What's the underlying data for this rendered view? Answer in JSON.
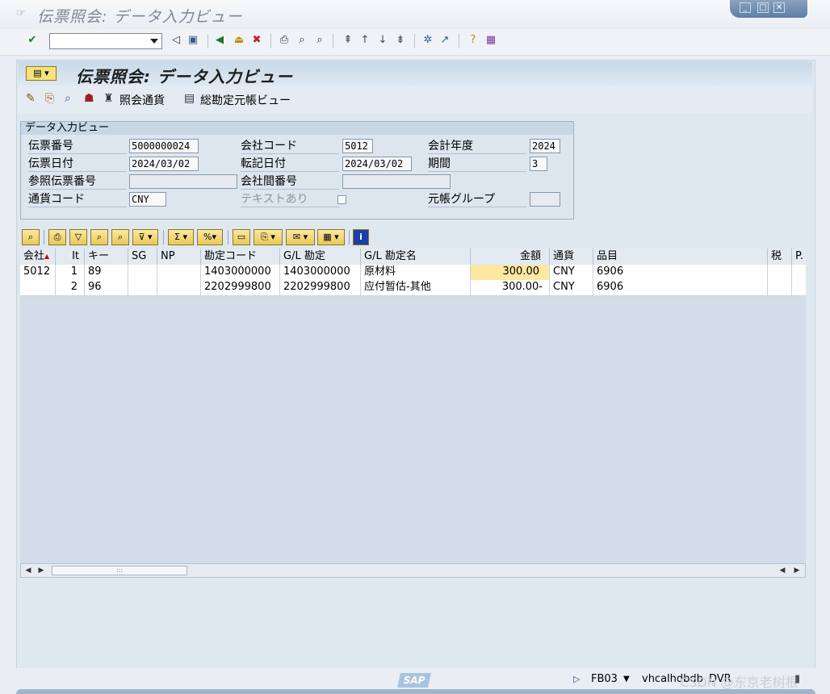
{
  "window": {
    "title": "伝票照会: データ入力ビュー",
    "buttons": [
      "minimize-icon",
      "maximize-icon",
      "close-icon"
    ]
  },
  "system_toolbar": {
    "command_field_value": "",
    "icons": [
      "enter-icon",
      "back-icon",
      "exit-icon",
      "cancel-icon",
      "print-icon",
      "find-icon",
      "find-next-icon",
      "first-page-icon",
      "prev-page-icon",
      "next-page-icon",
      "last-page-icon",
      "create-session-icon",
      "shortcut-icon",
      "help-icon",
      "customize-layout-icon"
    ]
  },
  "screen": {
    "title": "伝票照会: データ入力ビュー"
  },
  "app_toolbar": {
    "icons": [
      "display-change-icon",
      "other-document-icon",
      "overview-icon",
      "taxes-icon"
    ],
    "display_currency_label": "照会通貨",
    "general_ledger_view_label": "総勘定元帳ビュー"
  },
  "header_group": {
    "title": "データ入力ビュー",
    "fields": {
      "document_number": {
        "label": "伝票番号",
        "value": "5000000024"
      },
      "company_code": {
        "label": "会社コード",
        "value": "5012"
      },
      "fiscal_year": {
        "label": "会計年度",
        "value": "2024"
      },
      "document_date": {
        "label": "伝票日付",
        "value": "2024/03/02"
      },
      "posting_date": {
        "label": "転記日付",
        "value": "2024/03/02"
      },
      "period": {
        "label": "期間",
        "value": "3"
      },
      "reference": {
        "label": "参照伝票番号",
        "value": ""
      },
      "cross_company": {
        "label": "会社間番号",
        "value": ""
      },
      "currency": {
        "label": "通貨コード",
        "value": "CNY"
      },
      "text_exists": {
        "label": "テキストあり",
        "checked": false
      },
      "ledger_group": {
        "label": "元帳グループ",
        "value": ""
      }
    }
  },
  "grid": {
    "toolbar_icons": [
      "details-icon",
      "print-icon",
      "filter-icon",
      "find-icon",
      "find-next-icon",
      "set-filter-icon",
      "sum-icon",
      "subtotal-icon",
      "print-preview-icon",
      "export-icon",
      "mail-icon",
      "layout-icon",
      "info-icon"
    ],
    "columns": [
      "会社",
      "It",
      "キー",
      "SG",
      "NP",
      "勘定コード",
      "G/L 勘定",
      "G/L 勘定名",
      "金額",
      "通貨",
      "品目",
      "税",
      "P."
    ],
    "rows": [
      [
        "5012",
        "1",
        "89",
        "",
        "",
        "1403000000",
        "1403000000",
        "原材料",
        "300.00",
        "CNY",
        "6906",
        "",
        ""
      ],
      [
        "",
        "2",
        "96",
        "",
        "",
        "2202999800",
        "2202999800",
        "应付暂估-其他",
        "300.00-",
        "CNY",
        "6906",
        "",
        ""
      ]
    ],
    "sort_indicator": "▲"
  },
  "status_bar": {
    "logo": "SAP",
    "transaction": "FB03",
    "server": "vhcalhdbdb",
    "client": "DVR",
    "watermark": "CSDN @东京老树根"
  },
  "colors": {
    "accent": "#1c3ca8",
    "highlight_cell": "#fde7a1",
    "panel": "#dfe7ef"
  }
}
